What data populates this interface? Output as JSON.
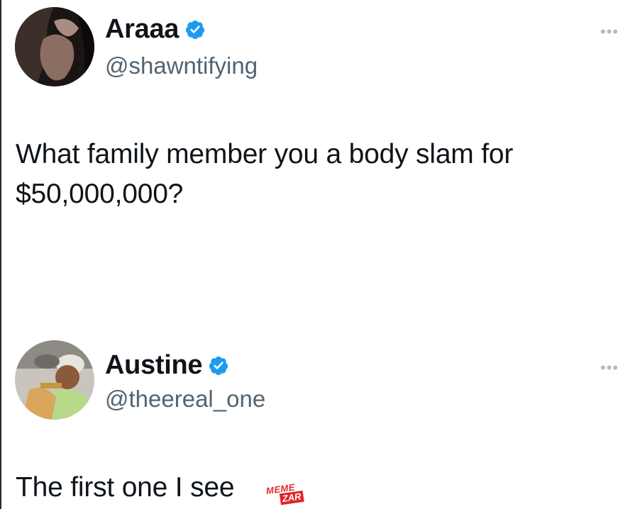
{
  "tweets": [
    {
      "display_name": "Araaa",
      "handle": "@shawntifying",
      "verified": true,
      "text_lines": [
        "What family member you a body slam for",
        "$50,000,000?"
      ],
      "more_icon": "more-horizontal-icon"
    },
    {
      "display_name": "Austine",
      "handle": "@theereal_one",
      "verified": true,
      "text_lines": [
        "The first one I see"
      ],
      "more_icon": "more-horizontal-icon"
    }
  ],
  "watermark": {
    "top": "MEME",
    "bottom": "ZAR"
  },
  "colors": {
    "verified": "#1d9bf0",
    "handle": "#536471",
    "text": "#0f1419",
    "watermark": "#e0262b"
  }
}
